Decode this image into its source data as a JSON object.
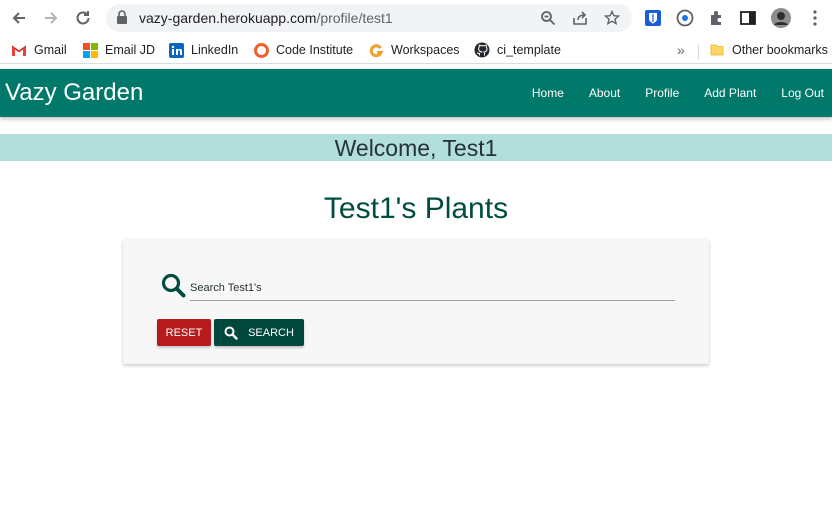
{
  "browser": {
    "url_host": "vazy-garden.herokuapp.com",
    "url_path": "/profile/test1",
    "bookmarks": [
      {
        "label": "Gmail",
        "icon": "gmail-icon"
      },
      {
        "label": "Email JD",
        "icon": "microsoft-icon"
      },
      {
        "label": "LinkedIn",
        "icon": "linkedin-icon"
      },
      {
        "label": "Code Institute",
        "icon": "code-institute-icon"
      },
      {
        "label": "Workspaces",
        "icon": "workspaces-icon"
      },
      {
        "label": "ci_template",
        "icon": "github-icon"
      }
    ],
    "overflow_label": "»",
    "other_bookmarks": "Other bookmarks"
  },
  "site": {
    "brand": "Vazy Garden",
    "nav": [
      "Home",
      "About",
      "Profile",
      "Add Plant",
      "Log Out"
    ],
    "colors": {
      "nav": "#00796b",
      "banner": "#b2dfdb",
      "reset": "#b71c1c",
      "search": "#00473c"
    }
  },
  "welcome": "Welcome, Test1",
  "page_title": "Test1's Plants",
  "search": {
    "placeholder": "Search Test1's",
    "reset_label": "Reset",
    "search_label": "Search"
  }
}
